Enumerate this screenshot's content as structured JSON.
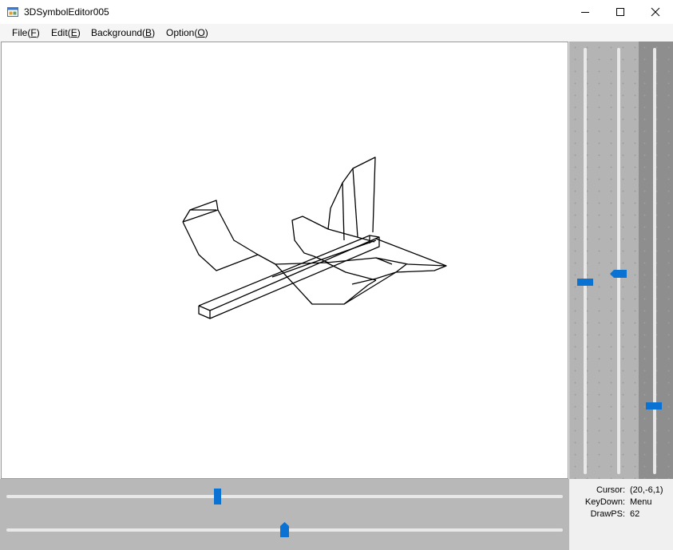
{
  "window": {
    "title": "3DSymbolEditor005",
    "icon": "app-window-icon"
  },
  "menu": {
    "items": [
      {
        "label": "File(",
        "key": "F",
        "suffix": ")"
      },
      {
        "label": "Edit(",
        "key": "E",
        "suffix": ")"
      },
      {
        "label": "Background(",
        "key": "B",
        "suffix": ")"
      },
      {
        "label": "Option(",
        "key": "O",
        "suffix": ")"
      }
    ]
  },
  "sliders": {
    "vertical_1": {
      "value": 0.55
    },
    "vertical_2": {
      "value": 0.53
    },
    "vertical_3": {
      "value": 0.84
    },
    "horizontal_1": {
      "value": 0.38
    },
    "horizontal_2": {
      "value": 0.5
    }
  },
  "status": {
    "cursor_label": "Cursor:",
    "cursor_value": "(20,-6,1)",
    "keydown_label": "KeyDown:",
    "keydown_value": "Menu",
    "drawps_label": "DrawPS:",
    "drawps_value": "62"
  },
  "colors": {
    "accent": "#0a72d2",
    "wire": "#000000"
  }
}
